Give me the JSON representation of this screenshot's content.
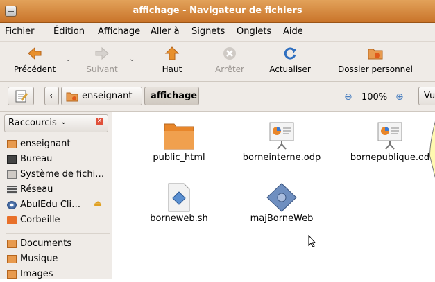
{
  "window": {
    "title": "affichage - Navigateur de fichiers"
  },
  "menu": [
    "Fichier",
    "Édition",
    "Affichage",
    "Aller à",
    "Signets",
    "Onglets",
    "Aide"
  ],
  "toolbar": {
    "back": "Précédent",
    "forward": "Suivant",
    "up": "Haut",
    "stop": "Arrêter",
    "reload": "Actualiser",
    "home": "Dossier personnel"
  },
  "location": {
    "parent": "enseignant",
    "current": "affichage",
    "zoom": "100%",
    "view": "Vu"
  },
  "sidebar": {
    "header": "Raccourcis",
    "items": [
      {
        "label": "enseignant",
        "icon": "home-folder-icon"
      },
      {
        "label": "Bureau",
        "icon": "desktop-icon"
      },
      {
        "label": "Système de fichi…",
        "icon": "filesystem-icon"
      },
      {
        "label": "Réseau",
        "icon": "network-icon"
      },
      {
        "label": "AbulEdu Cli…",
        "icon": "cdrom-icon"
      },
      {
        "label": "Corbeille",
        "icon": "trash-icon"
      },
      {
        "label": "Documents",
        "icon": "folder-icon"
      },
      {
        "label": "Musique",
        "icon": "folder-icon"
      },
      {
        "label": "Images",
        "icon": "folder-icon"
      }
    ]
  },
  "files": [
    {
      "name": "public_html",
      "type": "folder-icon"
    },
    {
      "name": "borneinterne.odp",
      "type": "presentation-icon"
    },
    {
      "name": "bornepublique.od",
      "type": "presentation-icon"
    },
    {
      "name": "borneweb.sh",
      "type": "script-icon"
    },
    {
      "name": "majBorneWeb",
      "type": "executable-icon"
    }
  ],
  "colors": {
    "titlebar": "#d98b3f",
    "panel": "#efebe7",
    "accent": "#e06a1f"
  }
}
